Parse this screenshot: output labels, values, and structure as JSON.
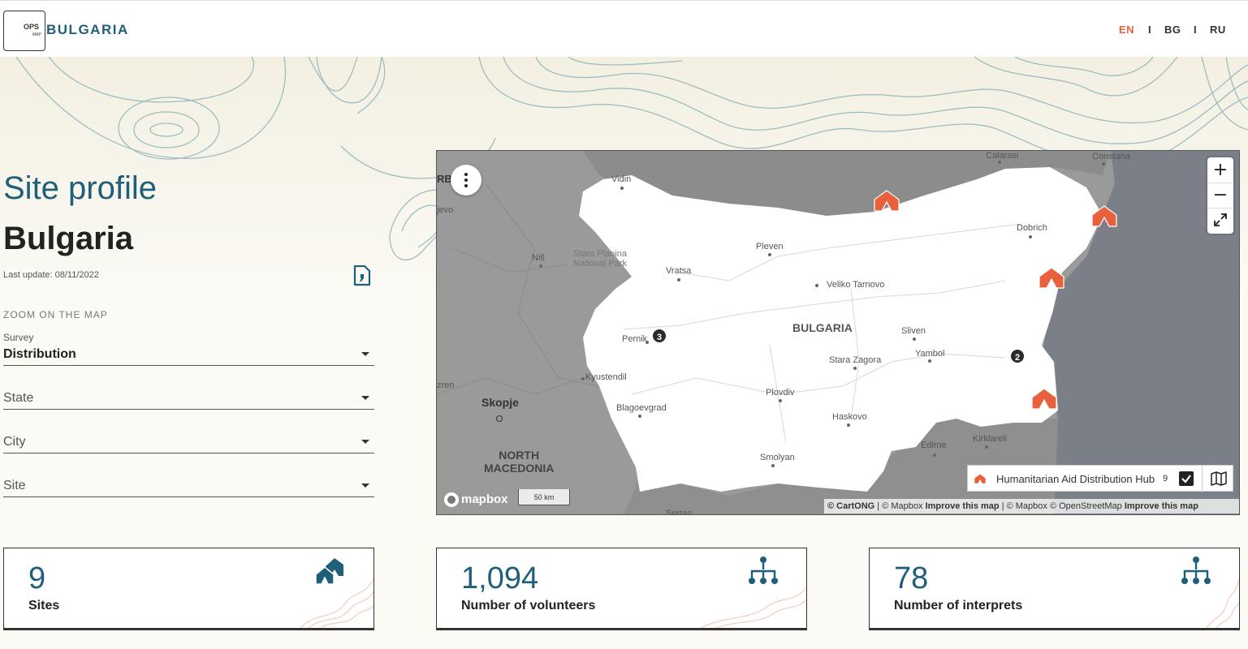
{
  "header": {
    "logo_ops": "OPS",
    "logo_map": "MAP",
    "country_brand": "BULGARIA",
    "languages": [
      "EN",
      "BG",
      "RU"
    ],
    "active_language": "EN",
    "separator": "I"
  },
  "profile": {
    "title": "Site profile",
    "country": "Bulgaria",
    "last_update": "Last update: 08/11/2022",
    "zoom_label": "ZOOM ON THE MAP"
  },
  "filters": {
    "survey_label": "Survey",
    "survey_value": "Distribution",
    "state_placeholder": "State",
    "city_placeholder": "City",
    "site_placeholder": "Site"
  },
  "map": {
    "country_label": "BULGARIA",
    "neighbour_country": "NORTH\nMACEDONIA",
    "cities": [
      "Vidin",
      "Pleven",
      "Vratsa",
      "Veliko Tarnovo",
      "Dobrich",
      "Sliven",
      "Yambol",
      "Stara Zagora",
      "Plovdiv",
      "Haskovo",
      "Smolyan",
      "Blagoevgrad",
      "Pernik",
      "Kyustendil",
      "Skopje",
      "Niš",
      "Edirne",
      "Kirklareli",
      "Calarasi",
      "Constana",
      "Serres",
      "Stara Planina\nNational Park"
    ],
    "edge_labels": [
      "RB",
      "jevo",
      "zren"
    ],
    "clusters": [
      "3",
      "2"
    ],
    "legend_label": "Humanitarian Aid Distribution Hub",
    "legend_count": "9",
    "scale_label": "50 km",
    "mapbox_label": "mapbox",
    "attribution": {
      "cartong": "© CartONG",
      "sep1": " | © Mapbox ",
      "improve1": "Improve this map",
      "sep2": " | © Mapbox © OpenStreetMap ",
      "improve2": "Improve this map"
    },
    "zoom_in": "+",
    "zoom_out": "−",
    "colors": {
      "land": "#ffffff",
      "neighbour": "#9a9a9a",
      "sea": "#7b7f87",
      "marker": "#e8603c"
    }
  },
  "stats": [
    {
      "value": "9",
      "label": "Sites",
      "icon": "tents-icon"
    },
    {
      "value": "1,094",
      "label": "Number of volunteers",
      "icon": "org-chart-icon"
    },
    {
      "value": "78",
      "label": "Number of interprets",
      "icon": "org-chart-icon"
    }
  ],
  "colors": {
    "brand": "#1f5f7a",
    "accent": "#e8603c",
    "background": "#fbfaf4"
  }
}
